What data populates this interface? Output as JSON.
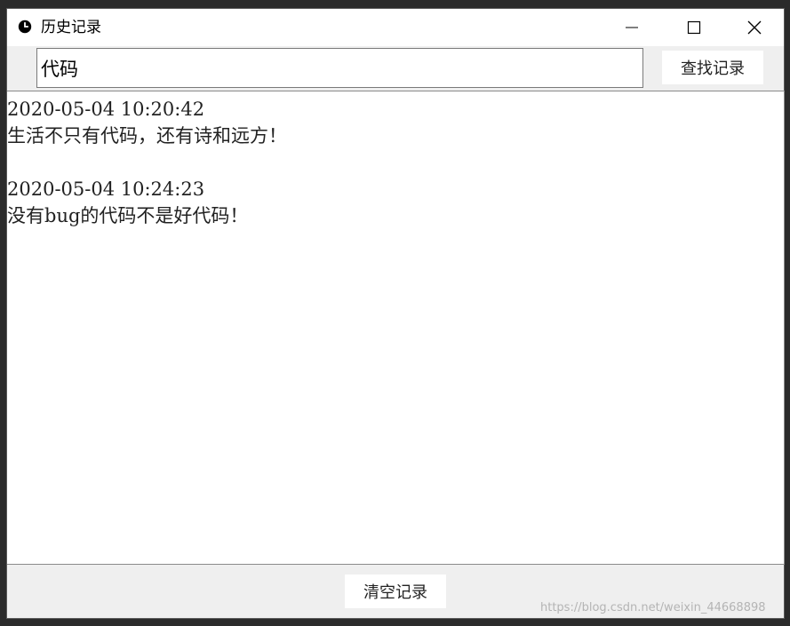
{
  "window": {
    "title": "历史记录",
    "title_icon": "clock-icon",
    "controls": {
      "minimize_icon": "minimize-icon",
      "maximize_icon": "maximize-icon",
      "close_icon": "close-icon"
    }
  },
  "search": {
    "value": "代码",
    "button_label": "查找记录"
  },
  "history": {
    "entries": [
      {
        "timestamp": "2020-05-04 10:20:42",
        "text": "生活不只有代码，还有诗和远方！"
      },
      {
        "timestamp": "2020-05-04 10:24:23",
        "text": "没有bug的代码不是好代码！"
      }
    ]
  },
  "footer": {
    "clear_button_label": "清空记录",
    "watermark": "https://blog.csdn.net/weixin_44668898"
  }
}
